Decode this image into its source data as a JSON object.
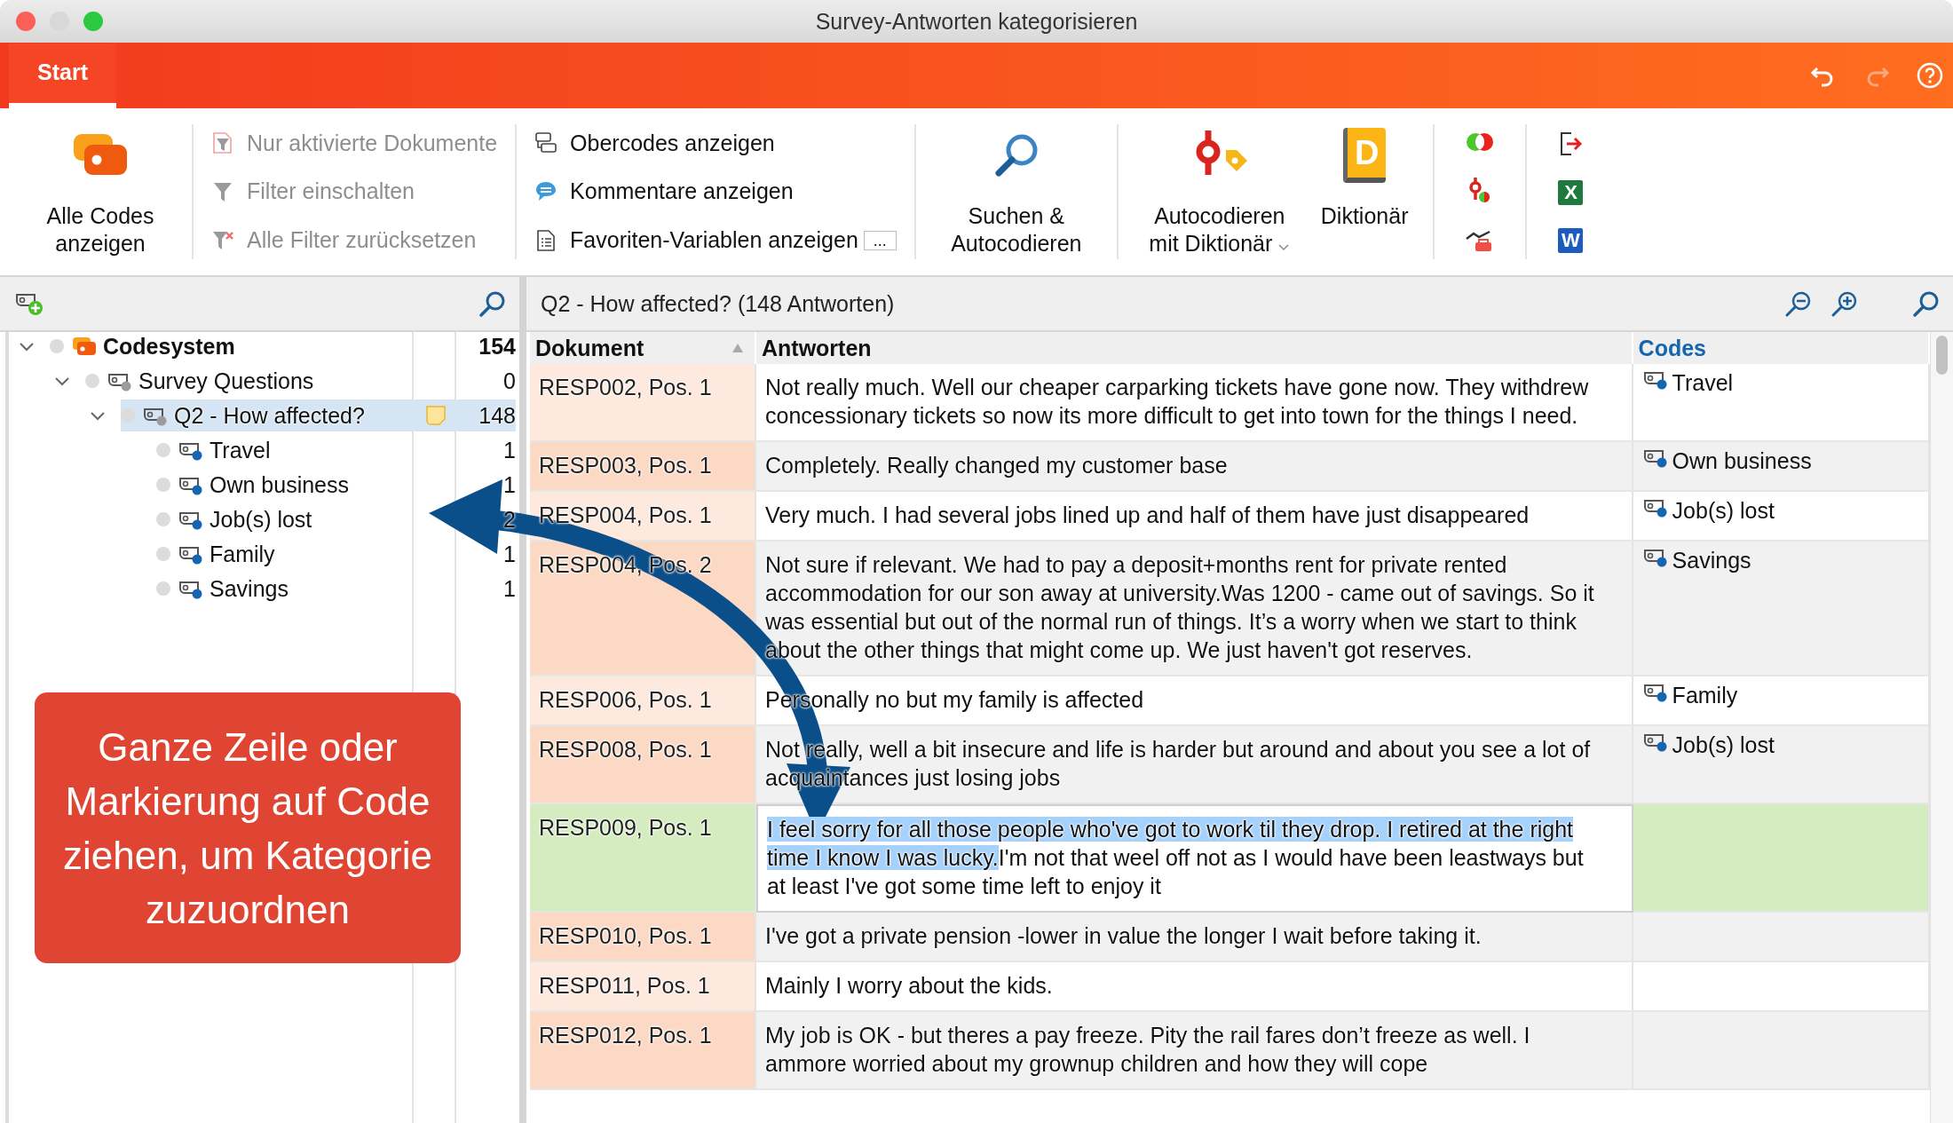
{
  "window": {
    "title": "Survey-Antworten kategorisieren"
  },
  "ribbon": {
    "tabs": [
      {
        "label": "Start",
        "selected": true
      }
    ],
    "undo_disabled": false,
    "redo_disabled": true
  },
  "toolbar": {
    "show_all_codes": {
      "label": "Alle Codes anzeigen"
    },
    "filter_items": [
      {
        "label": "Nur aktivierte Dokumente",
        "disabled": true
      },
      {
        "label": "Filter einschalten",
        "disabled": true
      },
      {
        "label": "Alle Filter zurücksetzen",
        "disabled": true
      }
    ],
    "view_items": [
      {
        "kind": "parents",
        "label": "Obercodes anzeigen"
      },
      {
        "kind": "comments",
        "label": "Kommentare anzeigen"
      },
      {
        "kind": "variables",
        "label": "Favoriten-Variablen anzeigen",
        "more": "..."
      }
    ],
    "search_button": {
      "label": "Suchen & Autocodieren"
    },
    "autocode_button": {
      "label": "Autocodieren mit Diktionär"
    },
    "dictionary_button": {
      "label": "Diktionär",
      "glyph": "D"
    },
    "export_icons": [
      {
        "kind": "export"
      },
      {
        "kind": "excel",
        "glyph": "X"
      },
      {
        "kind": "word",
        "glyph": "W"
      }
    ]
  },
  "codesystem": {
    "tree": [
      {
        "kind": "codesystem",
        "name": "Codesystem",
        "count": "154",
        "expanded": true,
        "selected": false,
        "memo": false,
        "children": [
          {
            "kind": "code",
            "name": "Survey Questions",
            "count": "0",
            "color": "#9b9b9b",
            "expanded": true,
            "selected": false,
            "memo": false,
            "children": [
              {
                "kind": "code",
                "name": "Q2 - How affected?",
                "count": "148",
                "color": "#9b9b9b",
                "expanded": true,
                "selected": true,
                "memo": true,
                "children": [
                  {
                    "kind": "code",
                    "name": "Travel",
                    "count": "1",
                    "color": "#1565b0",
                    "selected": false,
                    "memo": false
                  },
                  {
                    "kind": "code",
                    "name": "Own business",
                    "count": "1",
                    "color": "#1565b0",
                    "selected": false,
                    "memo": false
                  },
                  {
                    "kind": "code",
                    "name": "Job(s) lost",
                    "count": "2",
                    "color": "#1565b0",
                    "selected": false,
                    "memo": false
                  },
                  {
                    "kind": "code",
                    "name": "Family",
                    "count": "1",
                    "color": "#1565b0",
                    "selected": false,
                    "memo": false
                  },
                  {
                    "kind": "code",
                    "name": "Savings",
                    "count": "1",
                    "color": "#1565b0",
                    "selected": false,
                    "memo": false
                  }
                ]
              }
            ]
          }
        ]
      }
    ]
  },
  "responses": {
    "title": "Q2 - How affected? (148 Antworten)",
    "columns": [
      "Dokument",
      "Antworten",
      "Codes"
    ],
    "rows": [
      {
        "document": "RESP002, Pos. 1",
        "color": "#fde9de",
        "selected": false,
        "answer": "Not really much. Well our cheaper carparking tickets have gone now. They withdrew concessionary tickets so now its more difficult to get into town for the things I need.",
        "code": "Travel"
      },
      {
        "document": "RESP003, Pos. 1",
        "color": "#fcd9c5",
        "selected": false,
        "answer": "Completely. Really changed my customer base",
        "code": "Own business"
      },
      {
        "document": "RESP004, Pos. 1",
        "color": "#fde9de",
        "selected": false,
        "answer": "Very much. I had several jobs lined up and half of them have just disappeared",
        "code": "Job(s) lost"
      },
      {
        "document": "RESP004, Pos. 2",
        "color": "#fcd9c5",
        "selected": false,
        "answer": "Not sure if relevant. We had to pay a deposit+months rent for private rented accommodation for our son away at university.Was 1200 - came out of savings. So it was essential but out of the normal run of things. It’s a worry when we start to think about the other things that might come up. We just haven't got reserves.",
        "code": "Savings"
      },
      {
        "document": "RESP006, Pos. 1",
        "color": "#fde9de",
        "selected": false,
        "answer": "Personally no but my family is affected",
        "code": "Family"
      },
      {
        "document": "RESP008, Pos. 1",
        "color": "#fcd9c5",
        "selected": false,
        "answer": "Not really, well a bit insecure and life is harder but around and about you see a lot of acquaintances just losing jobs",
        "code": "Job(s) lost"
      },
      {
        "document": "RESP009, Pos. 1",
        "color": "#d4ecbf",
        "selected": true,
        "highlighted": "I feel sorry for all those people who've got to work til they drop. I retired at the right time I know I was lucky.",
        "answer": "I'm not that weel off not as I would have been leastways but at least I've got some time left to enjoy it"
      },
      {
        "document": "RESP010, Pos. 1",
        "color": "#fcd9c5",
        "selected": false,
        "answer": "I've got a private pension -lower in value the longer I wait before taking it."
      },
      {
        "document": "RESP011, Pos. 1",
        "color": "#fde9de",
        "selected": false,
        "answer": "Mainly I worry about the kids."
      },
      {
        "document": "RESP012, Pos. 1",
        "color": "#fcd9c5",
        "selected": false,
        "answer": "My job is OK - but theres a pay freeze. Pity the rail fares don’t freeze as well. I ammore worried about my grownup children and how they will cope"
      }
    ]
  },
  "callout": {
    "text": "Ganze Zeile oder Markierung auf Code ziehen, um Kategorie zuzuordnen"
  }
}
